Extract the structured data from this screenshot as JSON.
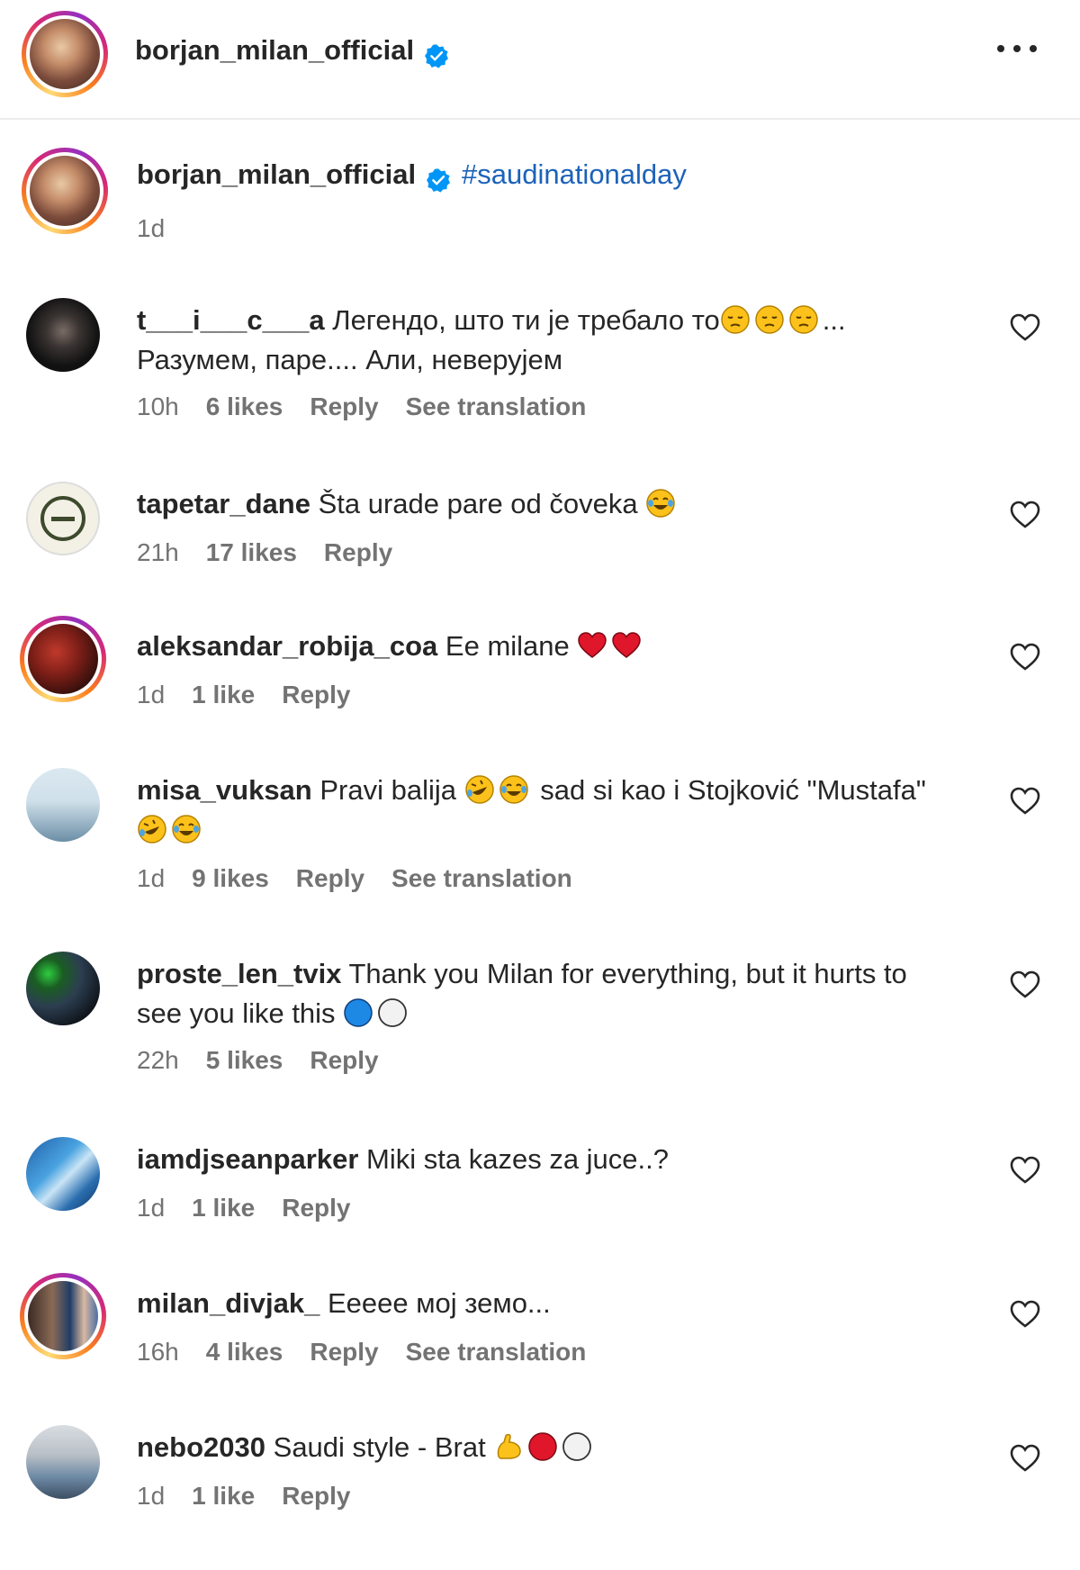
{
  "header": {
    "username": "borjan_milan_official",
    "verified_icon": "verified-badge-icon",
    "more_icon": "more-options-icon"
  },
  "caption": {
    "username": "borjan_milan_official",
    "hashtag": "#saudinationalday",
    "time": "1d"
  },
  "comments": [
    {
      "username": "t___i___c___a",
      "text1": "Легендо, што ти је требало то",
      "text_tail1": "...",
      "text2": "Разумем, паре.... Али, неверујем",
      "time": "10h",
      "likes": "6 likes",
      "reply": "Reply",
      "translate": "See translation"
    },
    {
      "username": "tapetar_dane",
      "text1": "Šta urade pare od čoveka",
      "time": "21h",
      "likes": "17 likes",
      "reply": "Reply"
    },
    {
      "username": "aleksandar_robija_coa",
      "text1": "Ee milane",
      "time": "1d",
      "likes": "1 like",
      "reply": "Reply"
    },
    {
      "username": "misa_vuksan",
      "text1": "Pravi balija",
      "text_mid": "sad si kao i Stojković \"Mustafa\"",
      "time": "1d",
      "likes": "9 likes",
      "reply": "Reply",
      "translate": "See translation"
    },
    {
      "username": "proste_len_tvix",
      "text1": "Thank you Milan for everything, but it hurts to",
      "text2": "see you like this",
      "time": "22h",
      "likes": "5 likes",
      "reply": "Reply"
    },
    {
      "username": "iamdjseanparker",
      "text1": "Miki sta kazes za juce..?",
      "time": "1d",
      "likes": "1 like",
      "reply": "Reply"
    },
    {
      "username": "milan_divjak_",
      "text1": "Eeeee мој земо...",
      "time": "16h",
      "likes": "4 likes",
      "reply": "Reply",
      "translate": "See translation"
    },
    {
      "username": "nebo2030",
      "text1": "Saudi style - Brat",
      "time": "1d",
      "likes": "1 like",
      "reply": "Reply"
    }
  ],
  "colors": {
    "accent": "#0095f6",
    "hashtag": "#1c62b9",
    "meta": "#737373",
    "text": "#262626"
  }
}
